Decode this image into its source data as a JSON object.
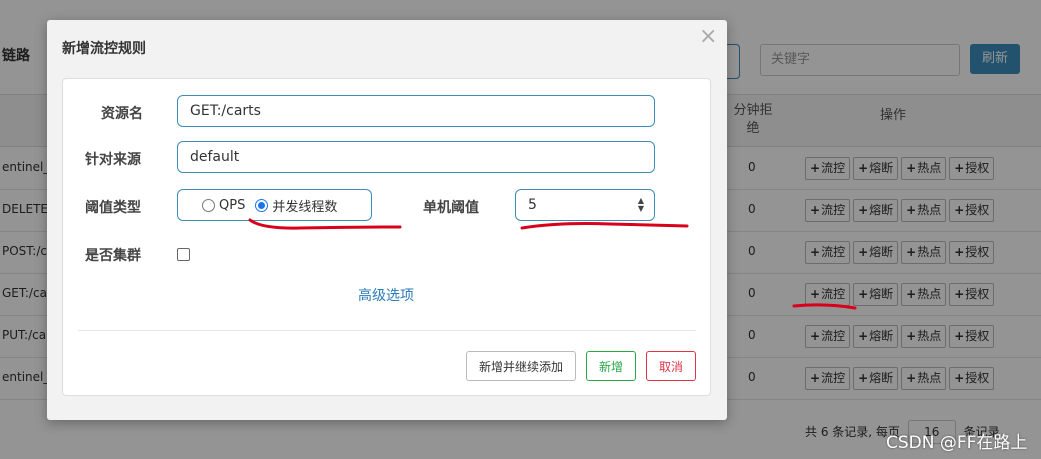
{
  "background": {
    "page_title": "链路",
    "search_placeholder": "关键字",
    "refresh_label": "刷新",
    "col_reject": "分钟拒绝",
    "col_ops": "操作",
    "rows": [
      {
        "resource": "entinel_sp",
        "reject": "0"
      },
      {
        "resource": "DELETE",
        "reject": "0"
      },
      {
        "resource": "POST:/c",
        "reject": "0"
      },
      {
        "resource": "GET:/car",
        "reject": "0"
      },
      {
        "resource": "PUT:/car",
        "reject": "0"
      },
      {
        "resource": "entinel_de",
        "reject": "0"
      }
    ],
    "row_buttons": [
      "流控",
      "熔断",
      "热点",
      "授权"
    ],
    "footer_prefix": "共 6 条记录, 每页",
    "page_size": "16",
    "footer_suffix": "条记录"
  },
  "modal": {
    "title": "新增流控规则",
    "close_glyph": "×",
    "resource_label": "资源名",
    "resource_value": "GET:/carts",
    "origin_label": "针对来源",
    "origin_value": "default",
    "threshold_type_label": "阈值类型",
    "radio_options": [
      {
        "label": "QPS",
        "checked": false
      },
      {
        "label": "并发线程数",
        "checked": true
      }
    ],
    "single_threshold_label": "单机阈值",
    "single_threshold_value": "5",
    "cluster_label": "是否集群",
    "cluster_checked": false,
    "advanced_label": "高级选项",
    "btn_continue": "新增并继续添加",
    "btn_add": "新增",
    "btn_cancel": "取消"
  },
  "watermark": "CSDN @FF在路上",
  "colors": {
    "primary": "#3c8dbc",
    "success": "#28a745",
    "danger": "#dc3545",
    "annotation": "#d9001b"
  }
}
